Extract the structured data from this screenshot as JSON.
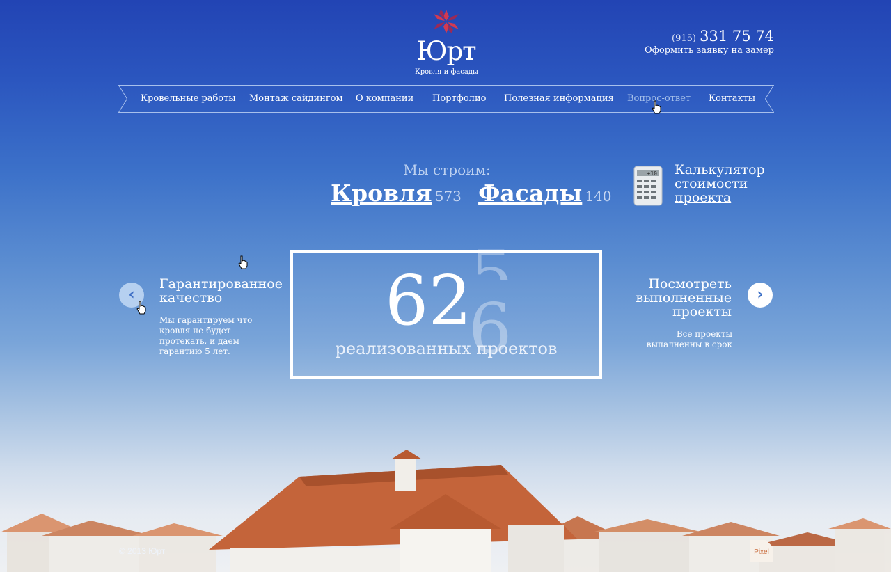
{
  "logo": {
    "name": "Юрт",
    "tagline": "Кровля и фасады"
  },
  "contacts": {
    "phone_code": "(915)",
    "phone_number": "331 75 74",
    "order_link": "Оформить заявку на замер"
  },
  "nav": {
    "items": [
      {
        "label": "Кровельные работы"
      },
      {
        "label": "Монтаж сайдингом"
      },
      {
        "label": "О компании"
      },
      {
        "label": "Портфолио"
      },
      {
        "label": "Полезная информация"
      },
      {
        "label": "Вопрос-ответ"
      },
      {
        "label": "Контакты"
      }
    ]
  },
  "we_build": {
    "label": "Мы строим:",
    "roof_label": "Кровля",
    "roof_count": "573",
    "facade_label": "Фасады",
    "facade_count": "140"
  },
  "calculator": {
    "line1": "Калькулятор",
    "line2": "стоимости",
    "line3": "проекта",
    "display": "+10"
  },
  "counter": {
    "value": "62",
    "ghost_top": "5",
    "ghost_bottom": "6",
    "label": "реализованных проектов"
  },
  "promo_left": {
    "title_line1": "Гарантированное",
    "title_line2": "качество",
    "text_line1": "Мы гарантируем что",
    "text_line2": "кровля не будет",
    "text_line3": "протекать, и даем",
    "text_line4": "гарантию 5 лет."
  },
  "promo_right": {
    "title_line1": "Посмотреть",
    "title_line2": "выполненные",
    "title_line3": "проекты",
    "text_line1": "Все проекты",
    "text_line2": "выпалненны в срок"
  },
  "arrows": {
    "prev": "‹",
    "next": "›"
  },
  "footer": {
    "copyright": "© 2013 Юрт",
    "badge": "Pixel"
  },
  "colors": {
    "sky_top": "#2244b4",
    "sky_bottom": "#eef0f3",
    "roof": "#c4643a",
    "logo_red": "#d23a52"
  }
}
